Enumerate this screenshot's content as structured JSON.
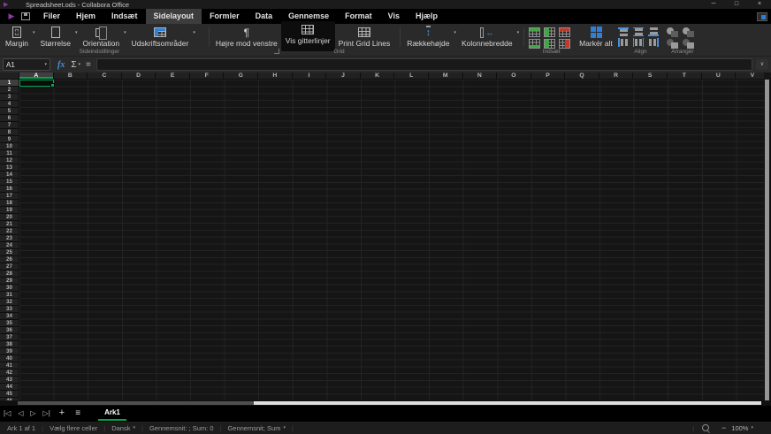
{
  "colors": {
    "accent_green": "#00A651",
    "logo_purple": "#8B3A9E",
    "align_blue": "#4A90D9",
    "insert_green": "#3FA845",
    "delete_red": "#C0392B",
    "select_all_blue": "#2F7FD6"
  },
  "title_bar": {
    "title": "Spreadsheet.ods - Collabora Office",
    "minimize": "─",
    "maximize": "□",
    "close": "×"
  },
  "menu_bar": {
    "items": [
      "Filer",
      "Hjem",
      "Indsæt",
      "Sidelayout",
      "Formler",
      "Data",
      "Gennemse",
      "Format",
      "Vis",
      "Hjælp"
    ],
    "active_item": "Sidelayout"
  },
  "ribbon": {
    "buttons": {
      "margin": "Margin",
      "size": "Størrelse",
      "orientation": "Orientation",
      "print_ranges": "Udskriftsområder",
      "right_to_left": "Højre mod venstre",
      "show_gridlines": "Vis gitterlinjer",
      "print_grid_lines": "Print Grid Lines",
      "row_height": "Rækkehøjde",
      "column_width": "Kolonnebredde",
      "select_all": "Markér alt"
    },
    "group_labels": {
      "page_settings": "Sideindstillinger",
      "grid": "Grid",
      "insert": "Indsæt",
      "align": "Align",
      "arrange": "Arrangér"
    },
    "active_button": "Vis gitterlinjer"
  },
  "formula_bar": {
    "name_box": "A1",
    "formula_value": ""
  },
  "icons": {
    "caret": "▾",
    "fx": "fx",
    "sum": "Σ",
    "equals": "=",
    "paragraph": "¶",
    "expand": "∨",
    "row_height_arrows": "↕",
    "column_width_arrow": "↔",
    "nav_first": "|◁",
    "nav_prev": "◁",
    "nav_next": "▷",
    "nav_last": "▷|",
    "add_sheet": "+",
    "sheet_menu": "≡",
    "zoom_out": "−",
    "zoom_in": "+"
  },
  "grid": {
    "columns": [
      "A",
      "B",
      "C",
      "D",
      "E",
      "F",
      "G",
      "H",
      "I",
      "J",
      "K",
      "L",
      "M",
      "N",
      "O",
      "P",
      "Q",
      "R",
      "S",
      "T",
      "U",
      "V"
    ],
    "row_count": 47,
    "selected_cell": "A1",
    "selected_column": "A",
    "selected_row": 1
  },
  "sheet_tabs": {
    "active_tab": "Ark1"
  },
  "status_bar": {
    "sheet_position": "Ark 1 af 1",
    "selection_mode": "Vælg flere celler",
    "language": "Dansk",
    "formula_status": "Gennemsnit: ; Sum: 0",
    "stat_functions": "Gennemsnit; Sum",
    "zoom_value": "100%"
  }
}
